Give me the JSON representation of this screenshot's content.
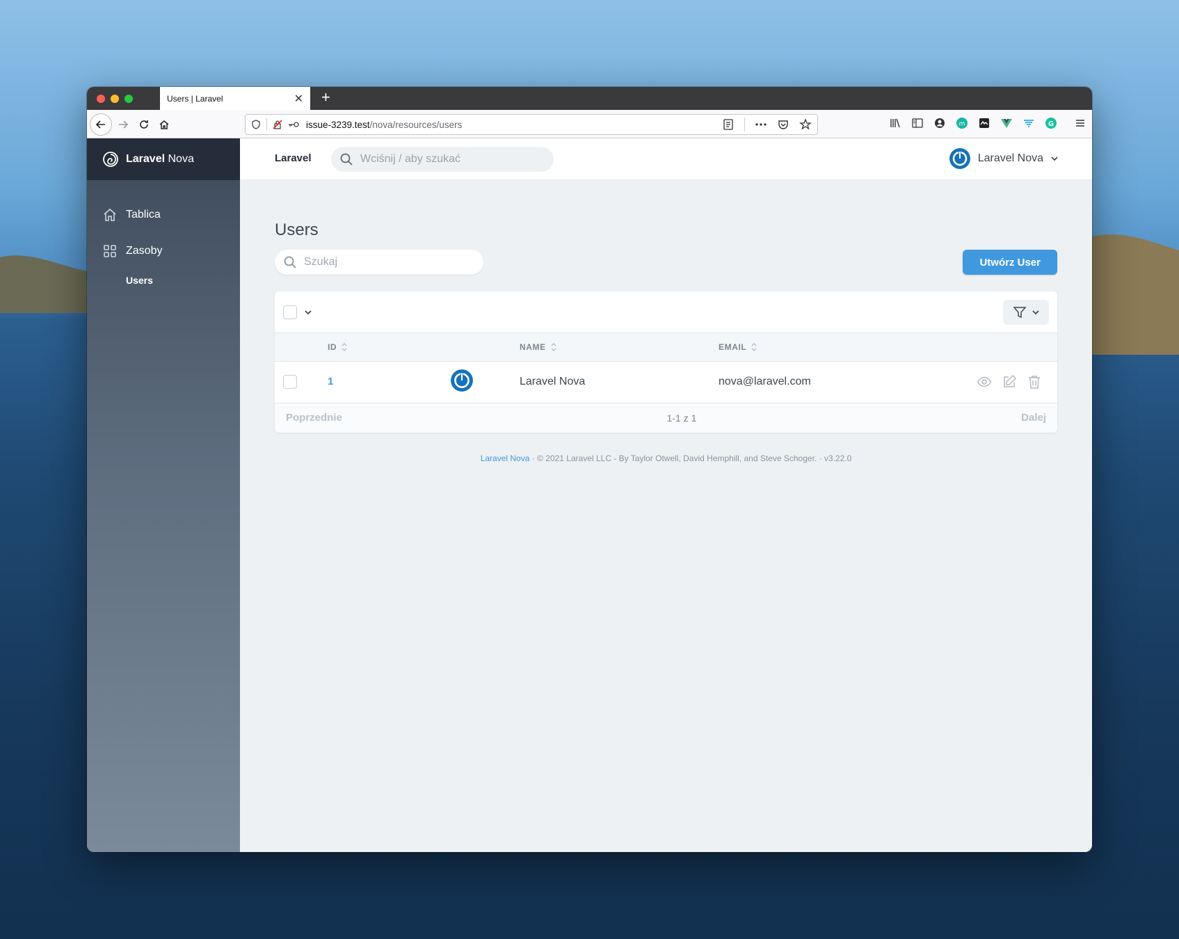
{
  "browser": {
    "tab_title": "Users | Laravel",
    "url_host": "issue-3239.test",
    "url_path": "/nova/resources/users"
  },
  "sidebar": {
    "brand_bold": "Laravel",
    "brand_rest": " Nova",
    "items": [
      {
        "label": "Tablica",
        "icon": "home-icon"
      },
      {
        "label": "Zasoby",
        "icon": "grid-icon"
      }
    ],
    "sub_items": [
      {
        "label": "Users"
      }
    ]
  },
  "topbar": {
    "brand": "Laravel",
    "search_placeholder": "Wciśnij / aby szukać",
    "user_name": "Laravel Nova"
  },
  "page": {
    "title": "Users",
    "search_placeholder": "Szukaj",
    "create_button": "Utwórz User"
  },
  "table": {
    "columns": [
      "ID",
      "NAME",
      "EMAIL"
    ],
    "rows": [
      {
        "id": "1",
        "name": "Laravel Nova",
        "email": "nova@laravel.com"
      }
    ]
  },
  "pagination": {
    "prev": "Poprzednie",
    "info": "1-1 z 1",
    "next": "Dalej"
  },
  "footer": {
    "link": "Laravel Nova",
    "text": "· © 2021 Laravel LLC - By Taylor Otwell, David Hemphill, and Steve Schoger. · v3.22.0"
  },
  "colors": {
    "accent": "#4099de",
    "sidebar_dark": "#252d3a"
  }
}
